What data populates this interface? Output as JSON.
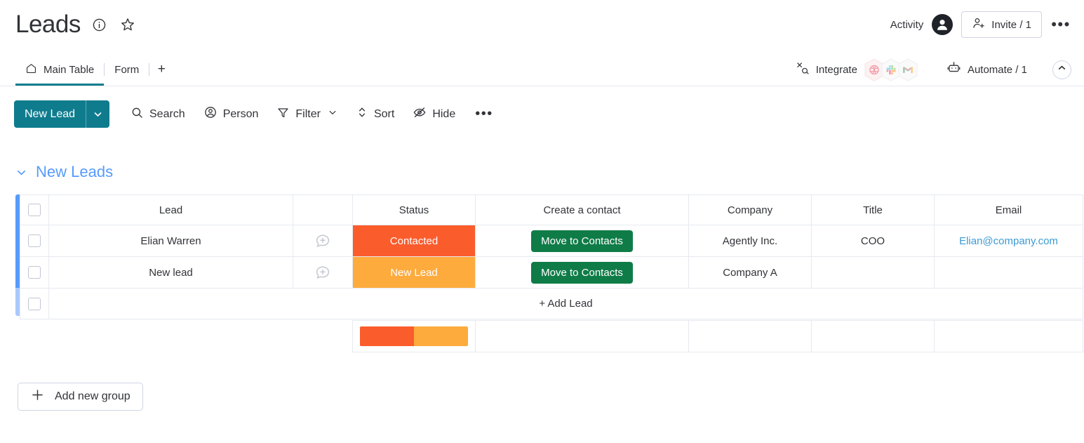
{
  "header": {
    "board_title": "Leads",
    "info_icon": "info-circle-icon",
    "favorite_icon": "star-icon",
    "activity_label": "Activity",
    "avatar": "user-avatar",
    "invite_label": "Invite / 1",
    "more_label": "•••"
  },
  "tabs": {
    "items": [
      {
        "label": "Main Table",
        "icon": "home-icon",
        "active": true
      },
      {
        "label": "Form",
        "icon": "",
        "active": false
      }
    ],
    "add_label": "+",
    "integrate_label": "Integrate",
    "integrations": [
      "dribbble-hex-icon",
      "slack-hex-icon",
      "gmail-hex-icon"
    ],
    "automate_label": "Automate / 1",
    "collapse_icon": "chevron-up-icon"
  },
  "toolbar": {
    "new_item_label": "New Lead",
    "new_item_caret": "chevron-down-icon",
    "items": [
      {
        "label": "Search",
        "icon": "search-icon"
      },
      {
        "label": "Person",
        "icon": "person-icon"
      },
      {
        "label": "Filter",
        "icon": "filter-icon",
        "caret": true
      },
      {
        "label": "Sort",
        "icon": "sort-icon"
      },
      {
        "label": "Hide",
        "icon": "eye-slash-icon"
      }
    ],
    "more_label": "•••"
  },
  "group": {
    "title": "New Leads",
    "collapse_icon": "chevron-down-icon",
    "color": "#579bfc"
  },
  "table": {
    "columns": [
      "Lead",
      "Status",
      "Create a contact",
      "Company",
      "Title",
      "Email"
    ],
    "rows": [
      {
        "lead": "Elian Warren",
        "status": {
          "label": "Contacted",
          "color": "#fb5c2c"
        },
        "create_contact": "Move to Contacts",
        "company": "Agently Inc.",
        "title": "COO",
        "email": "Elian@company.com"
      },
      {
        "lead": "New lead",
        "status": {
          "label": "New Lead",
          "color": "#fdab3d"
        },
        "create_contact": "Move to Contacts",
        "company": "Company A",
        "title": "",
        "email": ""
      }
    ],
    "add_row_label": "+ Add Lead",
    "summary": {
      "segments": [
        {
          "color": "#fb5c2c",
          "percent": 50
        },
        {
          "color": "#fdab3d",
          "percent": 50
        }
      ]
    }
  },
  "footer": {
    "add_group_label": "Add new group",
    "add_group_icon": "plus-icon"
  },
  "colors": {
    "brand_teal": "#0f7c8e",
    "group_blue": "#579bfc",
    "green_button": "#0f7c48",
    "link_blue": "#3d9ad4"
  }
}
